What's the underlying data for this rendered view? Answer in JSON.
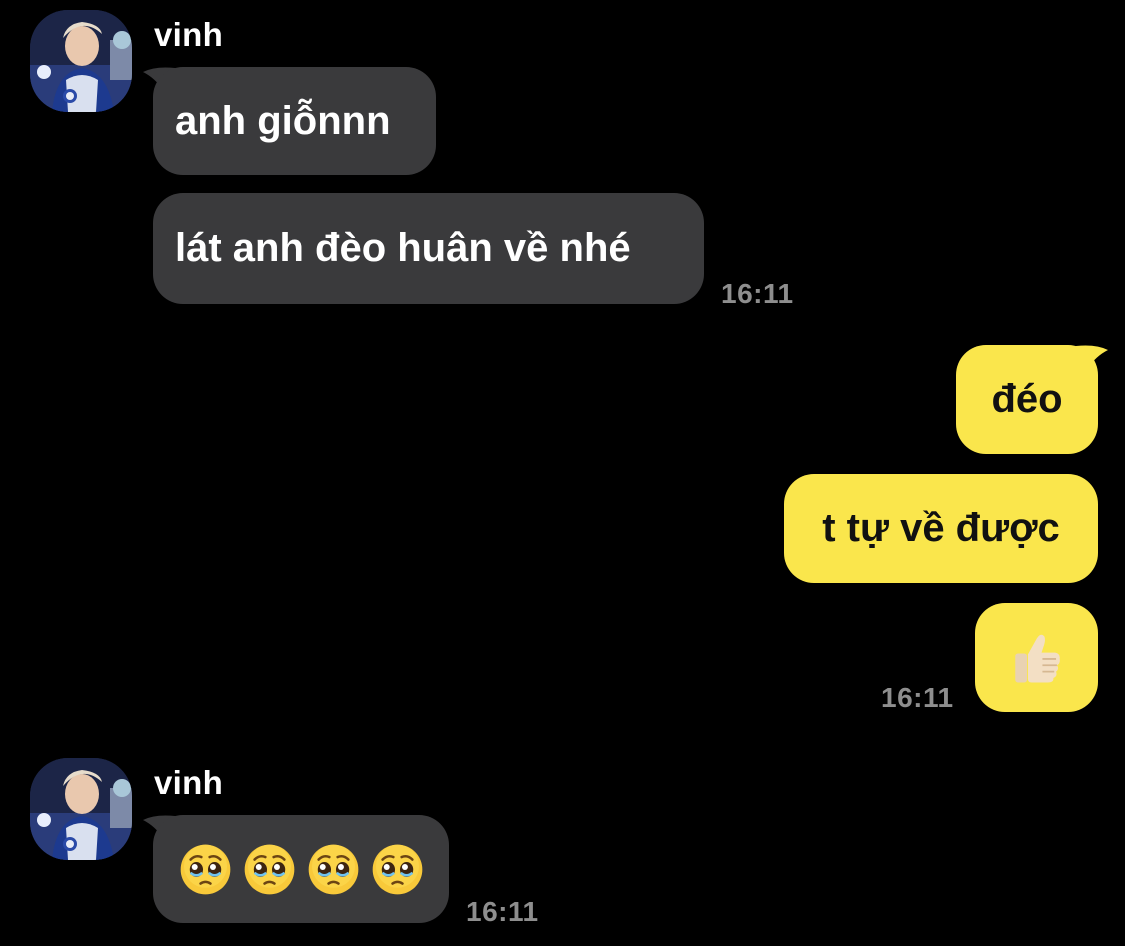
{
  "chat": {
    "colors": {
      "background": "#000000",
      "incoming_bubble": "#3a3a3c",
      "outgoing_bubble": "#fae64c",
      "timestamp": "#8e8e8e"
    },
    "groups": [
      {
        "sender": "vinh",
        "direction": "incoming",
        "messages": [
          {
            "text": "anh giỗnnn"
          },
          {
            "text": "lát anh đèo huân về nhé"
          }
        ],
        "time": "16:11"
      },
      {
        "direction": "outgoing",
        "messages": [
          {
            "text": "đéo"
          },
          {
            "text": "t tự về được"
          },
          {
            "emoji": "thumbs-up-light-skin-tone"
          }
        ],
        "time": "16:11"
      },
      {
        "sender": "vinh",
        "direction": "incoming",
        "messages": [
          {
            "emojis": [
              "pleading-face",
              "pleading-face",
              "pleading-face",
              "pleading-face"
            ]
          }
        ],
        "time": "16:11"
      }
    ]
  }
}
